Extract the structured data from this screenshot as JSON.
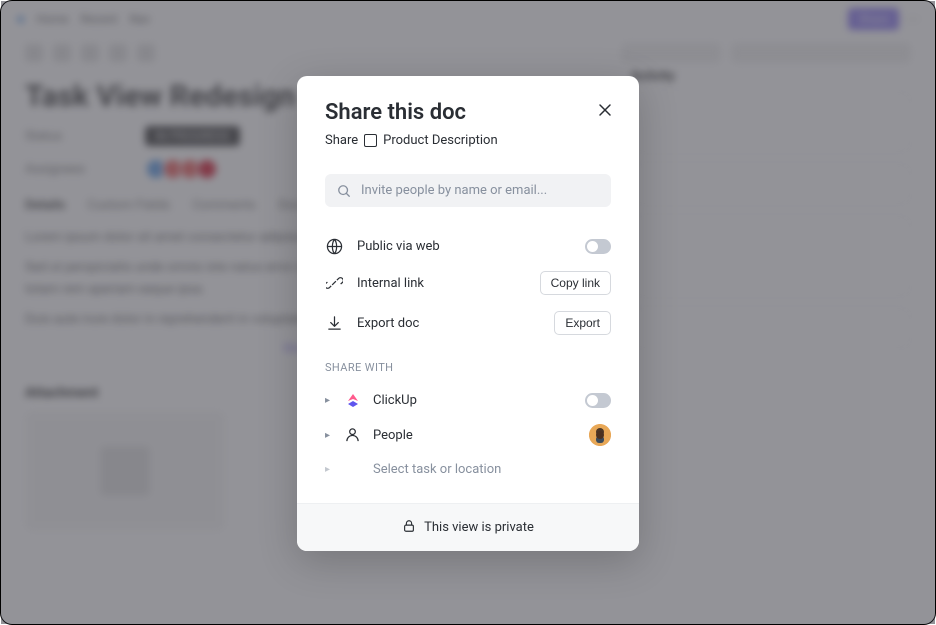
{
  "bg": {
    "title": "Task View Redesign",
    "topbar_items": [
      "Home",
      "Recent",
      "Nav"
    ],
    "status_label": "Status",
    "assignees_label": "Assignees",
    "tabs": [
      "Details",
      "Custom Fields",
      "Comments",
      "Docs"
    ],
    "paragraph1": "Lorem ipsum dolor sit amet consectetur adipiscing elit sed do eiusmod tempor incididunt ut labore.",
    "paragraph2": "Sed ut perspiciatis unde omnis iste natus error sit voluptatem accusantium doloremque laudantium totam rem aperiam eaque ipsa.",
    "paragraph3": "Duis aute irure dolor in reprehenderit in voluptate velit esse cillum dolore.",
    "attachment_title": "Attachment"
  },
  "modal": {
    "title": "Share this doc",
    "subtitle_prefix": "Share",
    "doc_name": "Product Description",
    "search_placeholder": "Invite people by name or email...",
    "options": {
      "public_web": "Public via web",
      "internal_link": "Internal link",
      "copy_link": "Copy link",
      "export_doc": "Export doc",
      "export": "Export"
    },
    "share_with_label": "SHARE WITH",
    "share_rows": {
      "clickup": "ClickUp",
      "people": "People",
      "select": "Select task or location"
    },
    "footer": "This view is private"
  }
}
